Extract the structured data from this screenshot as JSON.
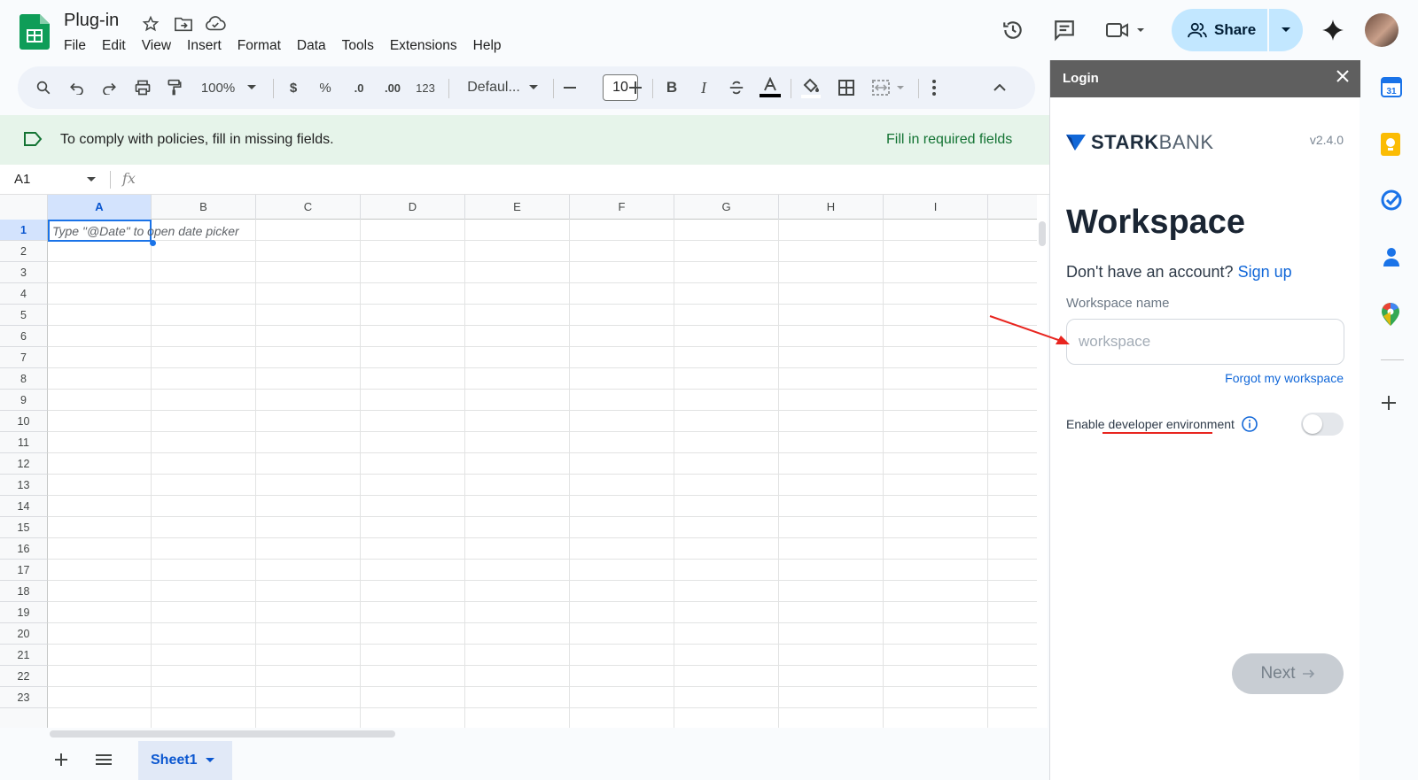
{
  "doc": {
    "title": "Plug-in",
    "menu": [
      "File",
      "Edit",
      "View",
      "Insert",
      "Format",
      "Data",
      "Tools",
      "Extensions",
      "Help"
    ]
  },
  "header": {
    "share_label": "Share"
  },
  "toolbar": {
    "zoom": "100%",
    "currency": "$",
    "percent": "%",
    "dec_decrease": ".0",
    "dec_increase": ".00",
    "number_format": "123",
    "font": "Defaul...",
    "font_size": "10",
    "bold": "B",
    "italic": "I"
  },
  "banner": {
    "message": "To comply with policies, fill in missing fields.",
    "action": "Fill in required fields"
  },
  "formula_bar": {
    "cell_ref": "A1",
    "fx": "fx"
  },
  "grid": {
    "columns": [
      "A",
      "B",
      "C",
      "D",
      "E",
      "F",
      "G",
      "H",
      "I"
    ],
    "rows": [
      "1",
      "2",
      "3",
      "4",
      "5",
      "6",
      "7",
      "8",
      "9",
      "10",
      "11",
      "12",
      "13",
      "14",
      "15",
      "16",
      "17",
      "18",
      "19",
      "20",
      "21",
      "22",
      "23"
    ],
    "active_cell_hint": "Type \"@Date\" to open date picker"
  },
  "sheet_tab": {
    "name": "Sheet1"
  },
  "panel": {
    "header_title": "Login",
    "brand": "STARKBANK",
    "brand_bold": "STARK",
    "brand_light": "BANK",
    "version": "v2.4.0",
    "title": "Workspace",
    "no_account": "Don't have an account?",
    "sign_up": "Sign up",
    "workspace_label": "Workspace name",
    "workspace_placeholder": "workspace",
    "forgot": "Forgot my workspace",
    "dev_env_prefix": "Enable ",
    "dev_env_link": "developer environment",
    "next_label": "Next",
    "dev_env_enabled": false
  },
  "colors": {
    "sheets_green": "#0f9d58",
    "share_bg": "#c2e7ff",
    "banner_bg": "#e6f4ea",
    "banner_action": "#137333",
    "link_blue": "#1167d8",
    "annotation_red": "#e8251f"
  },
  "icons": {
    "app_logo": "google-sheets-icon",
    "rail": [
      "calendar-icon",
      "keep-icon",
      "tasks-icon",
      "contacts-icon",
      "maps-icon",
      "add-icon"
    ]
  }
}
